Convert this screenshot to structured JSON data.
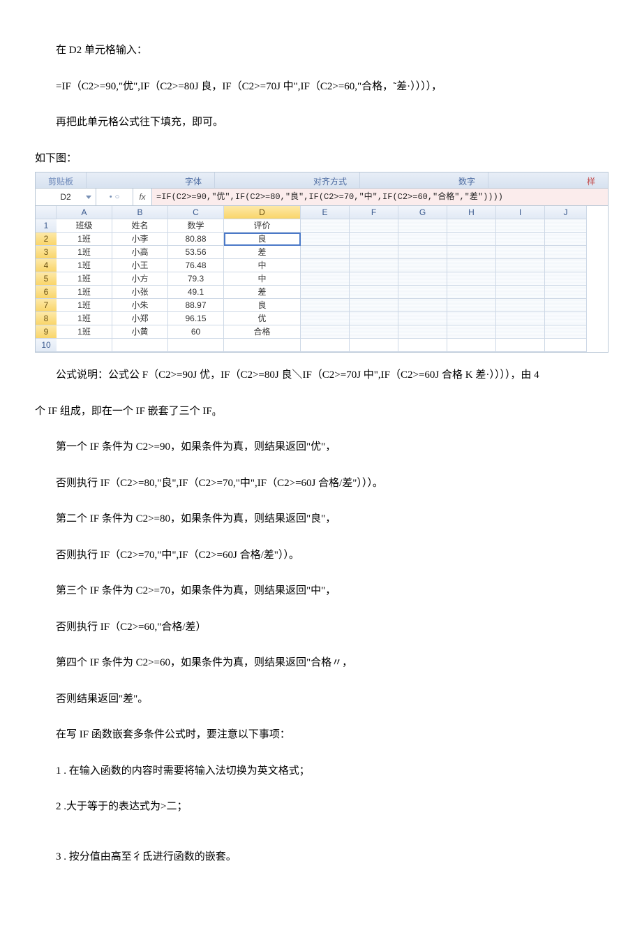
{
  "p1": "在 D2 单元格输入：",
  "p2": "=IF（C2>=90,\"优\",IF（C2>=80J 良，IF（C2>=70J 中\",IF（C2>=60,\"合格，˜差·）））），",
  "p3": "再把此单元格公式往下填充，即可。",
  "p4": "如下图：",
  "sheet": {
    "ribbon": {
      "tab1": "剪贴板",
      "tab2": "字体",
      "tab3": "对齐方式",
      "tab4": "数字",
      "tab5": "样"
    },
    "nameBox": "D2",
    "fxDot": "•",
    "fxCircle": "○",
    "fxLabel": "fx",
    "formula": "=IF(C2>=90,\"优\",IF(C2>=80,\"良\",IF(C2>=70,\"中\",IF(C2>=60,\"合格\",\"差\"))))",
    "cols": [
      "A",
      "B",
      "C",
      "D",
      "E",
      "F",
      "G",
      "H",
      "I",
      "J"
    ],
    "headerRow": {
      "a": "班级",
      "b": "姓名",
      "c": "数学",
      "d": "评价"
    },
    "rows": [
      {
        "n": "1",
        "a": "班级",
        "b": "姓名",
        "c": "数学",
        "d": "评价"
      },
      {
        "n": "2",
        "a": "1班",
        "b": "小李",
        "c": "80.88",
        "d": "良"
      },
      {
        "n": "3",
        "a": "1班",
        "b": "小高",
        "c": "53.56",
        "d": "差"
      },
      {
        "n": "4",
        "a": "1班",
        "b": "小王",
        "c": "76.48",
        "d": "中"
      },
      {
        "n": "5",
        "a": "1班",
        "b": "小方",
        "c": "79.3",
        "d": "中"
      },
      {
        "n": "6",
        "a": "1班",
        "b": "小张",
        "c": "49.1",
        "d": "差"
      },
      {
        "n": "7",
        "a": "1班",
        "b": "小朱",
        "c": "88.97",
        "d": "良"
      },
      {
        "n": "8",
        "a": "1班",
        "b": "小郑",
        "c": "96.15",
        "d": "优"
      },
      {
        "n": "9",
        "a": "1班",
        "b": "小黄",
        "c": "60",
        "d": "合格"
      },
      {
        "n": "10",
        "a": "",
        "b": "",
        "c": "",
        "d": ""
      }
    ]
  },
  "p5": "公式说明：公式公 F（C2>=90J 优，IF（C2>=80J 良＼IF（C2>=70J 中\",IF（C2>=60J 合格 K 差·）））），由 4",
  "p6": "个 IF 组成，即在一个 IF 嵌套了三个 IF₀",
  "p7": "第一个 IF 条件为 C2>=90，如果条件为真，则结果返回\"优\"，",
  "p8": "否则执行 IF（C2>=80,\"良\",IF（C2>=70,\"中\",IF（C2>=60J 合格/差\"）））。",
  "p9": "第二个 IF 条件为 C2>=80，如果条件为真，则结果返回\"良\"，",
  "p10": "否则执行 IF（C2>=70,\"中\",IF（C2>=60J 合格/差\"））。",
  "p11": "第三个 IF 条件为 C2>=70，如果条件为真，则结果返回\"中\"，",
  "p12": "否则执行 IF（C2>=60,\"合格/差）",
  "p13": "第四个 IF 条件为 C2>=60，如果条件为真，则结果返回\"合格〃，",
  "p14": "否则结果返回\"差\"。",
  "p15": "在写 IF 函数嵌套多条件公式时，要注意以下事项：",
  "p16": "1 . 在输入函数的内容时需要将输入法切换为英文格式；",
  "p17": "2 .大于等于的表达式为>二；",
  "p18": "3 . 按分值由高至彳氐进行函数的嵌套。"
}
